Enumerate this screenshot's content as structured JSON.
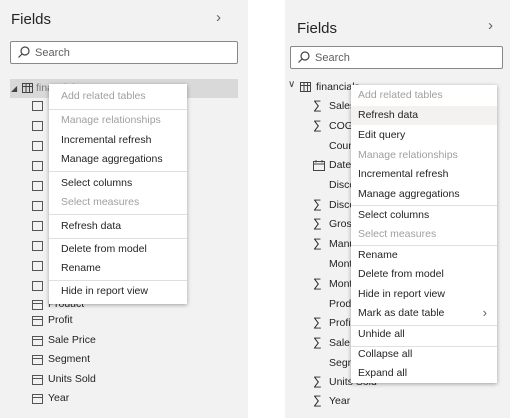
{
  "left_panel": {
    "title": "Fields",
    "search_placeholder": "Search",
    "table_name": "financials",
    "menu": [
      {
        "label": "Add related tables",
        "disabled": true
      },
      {
        "label": "Manage relationships",
        "disabled": true
      },
      {
        "label": "Incremental refresh",
        "disabled": false
      },
      {
        "label": "Manage aggregations",
        "disabled": false
      },
      {
        "label": "Select columns",
        "disabled": false
      },
      {
        "label": "Select measures",
        "disabled": true
      },
      {
        "label": "Refresh data",
        "disabled": false
      },
      {
        "label": "Delete from model",
        "disabled": false
      },
      {
        "label": "Rename",
        "disabled": false
      },
      {
        "label": "Hide in report view",
        "disabled": false
      }
    ],
    "fields": [
      "Product",
      "Profit",
      "Sale Price",
      "Segment",
      "Units Sold",
      "Year"
    ]
  },
  "right_panel": {
    "title": "Fields",
    "search_placeholder": "Search",
    "table_name": "financials",
    "fields": [
      "Sales",
      "COGS",
      "Country",
      "Date",
      "Discount Band",
      "Discounts",
      "Gross Sales",
      "Manufacturing Price",
      "Month Name",
      "Month Number",
      "Product",
      "Profit",
      "Sale Price",
      "Segment",
      "Units Sold",
      "Year"
    ],
    "menu": [
      {
        "label": "Add related tables",
        "disabled": true
      },
      {
        "label": "Refresh data",
        "disabled": false
      },
      {
        "label": "Edit query",
        "disabled": false
      },
      {
        "label": "Manage relationships",
        "disabled": true
      },
      {
        "label": "Incremental refresh",
        "disabled": false
      },
      {
        "label": "Manage aggregations",
        "disabled": false
      },
      {
        "label": "Select columns",
        "disabled": false
      },
      {
        "label": "Select measures",
        "disabled": true
      },
      {
        "label": "Rename",
        "disabled": false
      },
      {
        "label": "Delete from model",
        "disabled": false
      },
      {
        "label": "Hide in report view",
        "disabled": false
      },
      {
        "label": "Mark as date table",
        "disabled": false
      },
      {
        "label": "Unhide all",
        "disabled": false
      },
      {
        "label": "Collapse all",
        "disabled": false
      },
      {
        "label": "Expand all",
        "disabled": false
      }
    ]
  },
  "icons": {
    "chevron": "chevron-right-icon",
    "search": "search-icon",
    "table": "table-icon",
    "sigma": "sigma-icon",
    "calendar": "calendar-icon",
    "expand": "expand-caret-icon",
    "submenu": "submenu-chevron-icon"
  },
  "colors": {
    "panel_bg": "#f2f2f2",
    "menu_bg": "#ffffff",
    "disabled_text": "#a19f9d",
    "highlight": "#f3f2f1"
  }
}
